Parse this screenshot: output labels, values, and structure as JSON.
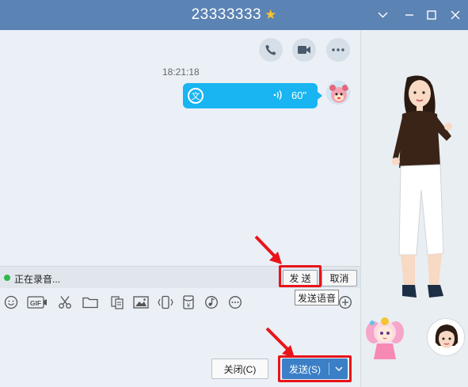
{
  "window": {
    "title": "23333333",
    "vip_icon": "star-icon",
    "controls": [
      "chevron-down-icon",
      "minimize-icon",
      "maximize-icon",
      "close-icon"
    ],
    "accent_color": "#5b83b4"
  },
  "chat": {
    "header_buttons": [
      "phone-icon",
      "video-icon",
      "more-icon"
    ],
    "timestamp": "18:21:18",
    "voice_message": {
      "duration": "60\"",
      "convert_icon_glyph": "文",
      "bubble_color": "#19b4f2"
    }
  },
  "recording": {
    "status": "正在录音...",
    "send_label": "发 送",
    "cancel_label": "取消",
    "send_tooltip": "发送语音"
  },
  "toolbar": {
    "tools": [
      "emoji-icon",
      "gif-icon",
      "scissors-icon",
      "folder-icon",
      "doc-icon",
      "image-icon",
      "shake-icon",
      "red-packet-icon",
      "music-icon",
      "more-circle-icon",
      "add-icon"
    ],
    "gif_label": "GIF"
  },
  "footer": {
    "close_label": "关闭(C)",
    "send_label": "发送(S)"
  },
  "annotation": {
    "highlight_color": "#e8141a"
  }
}
